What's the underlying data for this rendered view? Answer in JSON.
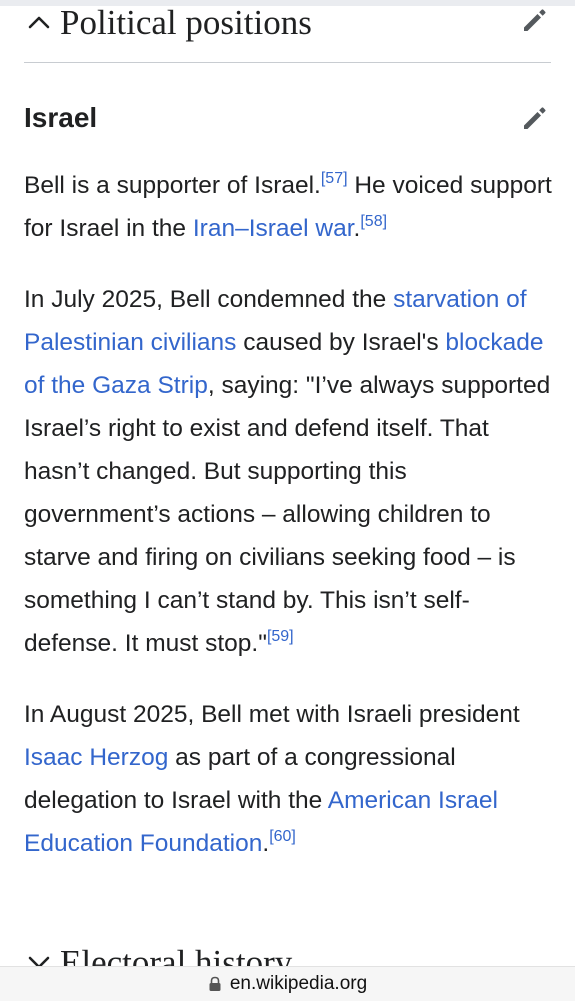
{
  "header": {
    "section_title": "Political positions",
    "subsection_title": "Israel"
  },
  "paragraphs": [
    {
      "segments": [
        {
          "text": "Bell is a supporter of Israel."
        },
        {
          "text": "[57]",
          "ref": true
        },
        {
          "text": " He voiced support for Israel in the "
        },
        {
          "text": "Iran–Israel war",
          "link": true
        },
        {
          "text": "."
        },
        {
          "text": "[58]",
          "ref": true
        }
      ]
    },
    {
      "segments": [
        {
          "text": "In July 2025, Bell condemned the "
        },
        {
          "text": "starvation of Palestinian civilians",
          "link": true
        },
        {
          "text": " caused by Israel's "
        },
        {
          "text": "blockade of the Gaza Strip",
          "link": true
        },
        {
          "text": ", saying: \"I’ve always supported Israel’s right to exist and defend itself. That hasn’t changed. But supporting this government’s actions – allowing children to starve and firing on civilians seeking food – is something I can’t stand by. This isn’t self-defense. It must stop.\""
        },
        {
          "text": "[59]",
          "ref": true
        }
      ]
    },
    {
      "segments": [
        {
          "text": "In August 2025, Bell met with Israeli president "
        },
        {
          "text": "Isaac Herzog",
          "link": true
        },
        {
          "text": " as part of a congressional delegation to Israel with the "
        },
        {
          "text": "American Israel Education Foundation",
          "link": true
        },
        {
          "text": "."
        },
        {
          "text": "[60]",
          "ref": true
        }
      ]
    }
  ],
  "next_section": {
    "title": "Electoral history"
  },
  "browser": {
    "url": "en.wikipedia.org"
  },
  "colors": {
    "link": "#3366cc",
    "text": "#202122",
    "divider": "#c8ccd1"
  },
  "icons": {
    "collapse": "chevron-up-icon",
    "expand": "chevron-down-icon",
    "edit": "pencil-edit-icon",
    "secure": "lock-icon"
  }
}
